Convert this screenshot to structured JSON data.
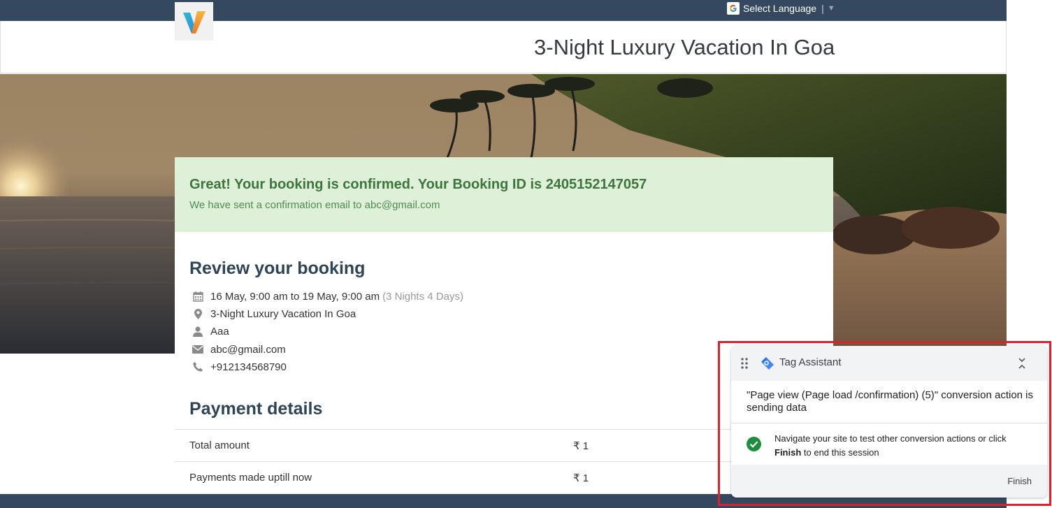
{
  "language_widget": {
    "label": "Select Language",
    "separator": "|",
    "caret": "▼"
  },
  "header": {
    "title": "3-Night Luxury Vacation In Goa"
  },
  "confirmation": {
    "title": "Great! Your booking is confirmed. Your Booking ID is 2405152147057",
    "subtitle": "We have sent a confirmation email to abc@gmail.com"
  },
  "review": {
    "heading": "Review your booking",
    "dates": "16 May, 9:00 am to 19 May, 9:00 am",
    "duration": "(3 Nights 4 Days)",
    "location": "3-Night Luxury Vacation In Goa",
    "name": "Aaa",
    "email": "abc@gmail.com",
    "phone": "+912134568790"
  },
  "payment": {
    "heading": "Payment details",
    "rows": [
      {
        "label": "Total amount",
        "value": "₹ 1"
      },
      {
        "label": "Payments made uptill now",
        "value": "₹ 1"
      }
    ]
  },
  "tag_assistant": {
    "title": "Tag Assistant",
    "message": "\"Page view (Page load /confirmation) (5)\" conversion action is sending data",
    "note_before": "Navigate your site to test other conversion actions or click ",
    "note_bold": "Finish",
    "note_after": " to end this session",
    "finish_label": "Finish"
  },
  "colors": {
    "topbar": "#344860",
    "confirm_bg": "#dff0d8",
    "confirm_text": "#3c763d",
    "heading": "#2e4457",
    "highlight_outline": "#e0202a",
    "ta_check": "#1e8e3e"
  }
}
